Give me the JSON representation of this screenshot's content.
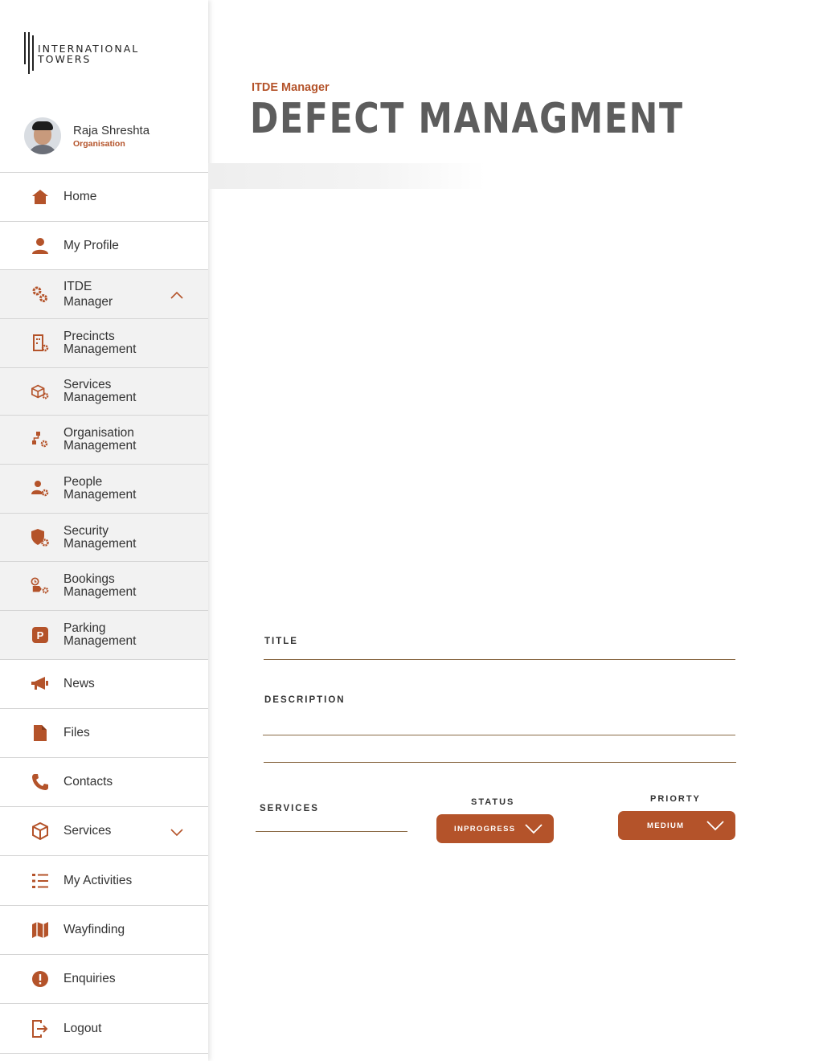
{
  "brand": {
    "logo_line1": "INTERNATIONAL",
    "logo_line2": "TOWERS"
  },
  "user": {
    "name": "Raja Shreshta",
    "role": "Organisation"
  },
  "accent_color": "#b4532a",
  "sidebar": {
    "items": [
      {
        "label": "Home",
        "icon": "home-icon"
      },
      {
        "label": "My Profile",
        "icon": "user-icon"
      },
      {
        "label": "ITDE\nManager",
        "icon": "gears-icon",
        "expanded": true
      },
      {
        "label": "Precincts\nManagement",
        "icon": "building-gear-icon"
      },
      {
        "label": "Services\nManagement",
        "icon": "box-gear-icon"
      },
      {
        "label": "Organisation\nManagement",
        "icon": "org-gear-icon"
      },
      {
        "label": "People\nManagement",
        "icon": "people-gear-icon"
      },
      {
        "label": "Security\nManagement",
        "icon": "shield-gear-icon"
      },
      {
        "label": "Bookings\nManagement",
        "icon": "bookings-gear-icon"
      },
      {
        "label": "Parking\nManagement",
        "icon": "parking-icon"
      },
      {
        "label": "News",
        "icon": "megaphone-icon"
      },
      {
        "label": "Files",
        "icon": "file-icon"
      },
      {
        "label": "Contacts",
        "icon": "phone-icon"
      },
      {
        "label": "Services",
        "icon": "box-icon",
        "expanded": false
      },
      {
        "label": "My Activities",
        "icon": "list-icon"
      },
      {
        "label": "Wayfinding",
        "icon": "map-icon"
      },
      {
        "label": "Enquiries",
        "icon": "exclamation-icon"
      },
      {
        "label": "Logout",
        "icon": "logout-icon"
      }
    ]
  },
  "page": {
    "eyebrow": "ITDE Manager",
    "title": "DEFECT MANAGMENT"
  },
  "form": {
    "title_label": "TITLE",
    "description_label": "DESCRIPTION",
    "services_label": "SERVICES",
    "status_label": "STATUS",
    "status_value": "INPROGRESS",
    "priority_label": "PRIORTY",
    "priority_value": "MEDIUM"
  }
}
